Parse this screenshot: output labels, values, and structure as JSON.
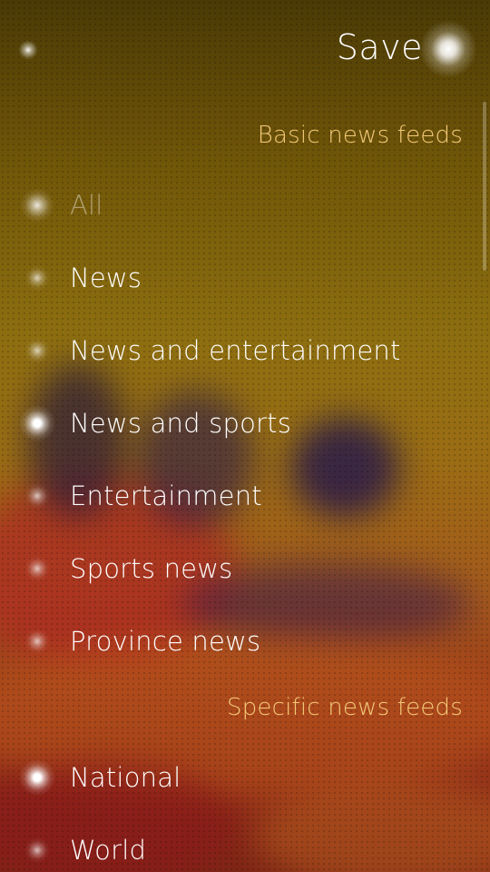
{
  "header": {
    "save_label": "Save"
  },
  "sections": [
    {
      "title": "Basic news feeds",
      "items": [
        {
          "label": "All",
          "state": "disabled"
        },
        {
          "label": "News",
          "state": "off"
        },
        {
          "label": "News and entertainment",
          "state": "off"
        },
        {
          "label": "News and sports",
          "state": "on"
        },
        {
          "label": "Entertainment",
          "state": "off"
        },
        {
          "label": "Sports news",
          "state": "off"
        },
        {
          "label": "Province news",
          "state": "off"
        }
      ]
    },
    {
      "title": "Specific news feeds",
      "items": [
        {
          "label": "National",
          "state": "on"
        },
        {
          "label": "World",
          "state": "off"
        }
      ]
    }
  ],
  "colors": {
    "section_header": "#f3c97a",
    "text": "#ffffff",
    "background_top": "#4a3a06",
    "background_bottom": "#7e2616"
  }
}
